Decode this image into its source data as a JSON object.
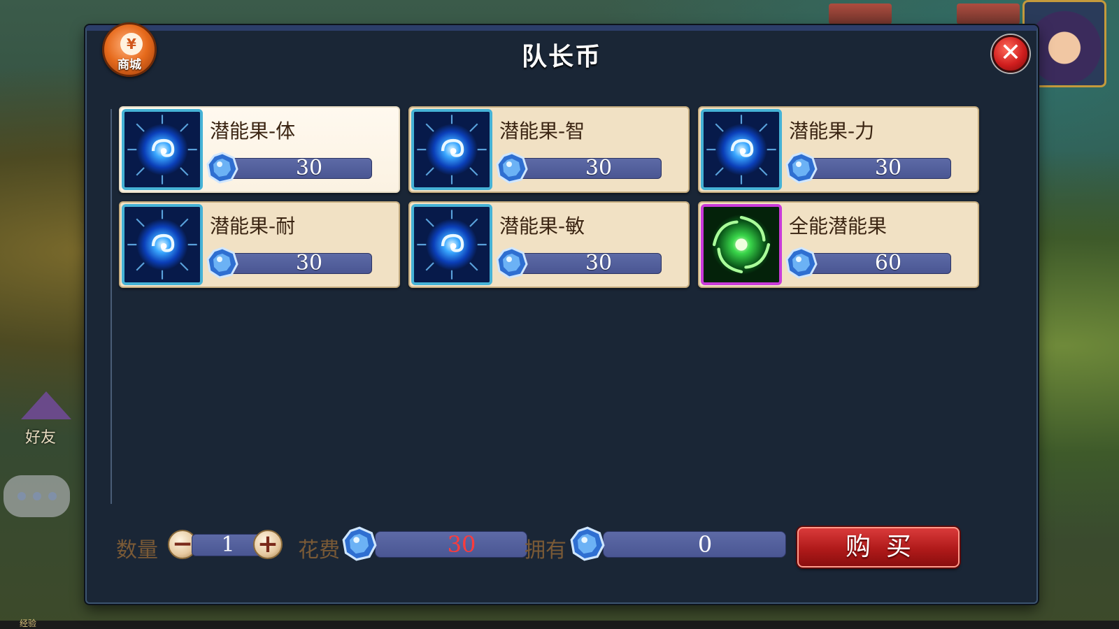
{
  "dialog": {
    "title": "队长币",
    "shop_label": "商城",
    "shop_symbol": "¥",
    "close_symbol": "✕"
  },
  "items": [
    {
      "name": "潜能果-体",
      "price": "30",
      "icon": "blue-potential-fruit-icon",
      "selected": true
    },
    {
      "name": "潜能果-智",
      "price": "30",
      "icon": "blue-potential-fruit-icon",
      "selected": false
    },
    {
      "name": "潜能果-力",
      "price": "30",
      "icon": "blue-potential-fruit-icon",
      "selected": false
    },
    {
      "name": "潜能果-耐",
      "price": "30",
      "icon": "blue-potential-fruit-icon",
      "selected": false
    },
    {
      "name": "潜能果-敏",
      "price": "30",
      "icon": "blue-potential-fruit-icon",
      "selected": false
    },
    {
      "name": "全能潜能果",
      "price": "60",
      "icon": "green-all-potential-fruit-icon",
      "selected": false
    }
  ],
  "purchase": {
    "quantity_label": "数量",
    "quantity": "1",
    "minus_symbol": "−",
    "plus_symbol": "+",
    "cost_label": "花费",
    "cost": "30",
    "own_label": "拥有",
    "owned": "0",
    "buy_label": "购买"
  },
  "background": {
    "friend_label": "好友",
    "exp_label": "经验"
  },
  "colors": {
    "dialog_bg": "#1a2636",
    "card_bg": "#f1e1c4",
    "price_bar": "#5d6aa6",
    "cost_text": "#ff3b3b",
    "buy_button": "#c22222",
    "blue_frame": "#45b2d6",
    "purple_frame": "#c93ad9"
  }
}
